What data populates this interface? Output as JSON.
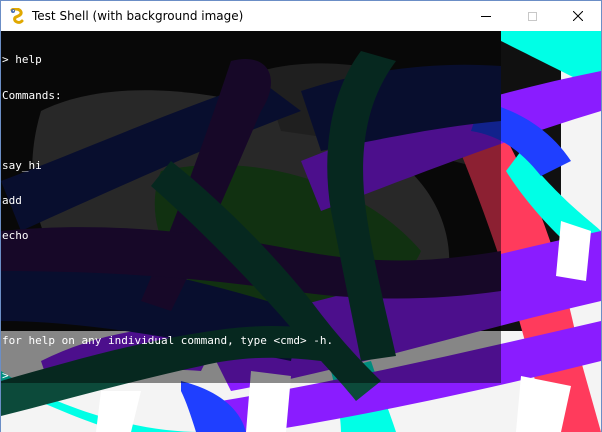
{
  "window": {
    "title": "Test Shell (with background image)",
    "icons": {
      "app": "snake-icon",
      "minimize": "minimize-icon",
      "maximize": "maximize-icon",
      "close": "close-icon"
    }
  },
  "console": {
    "lines": [
      "> help",
      "Commands:",
      "",
      "say_hi",
      "add",
      "echo",
      "",
      "",
      "for help on any individual command, type <cmd> -h.",
      ">"
    ]
  }
}
